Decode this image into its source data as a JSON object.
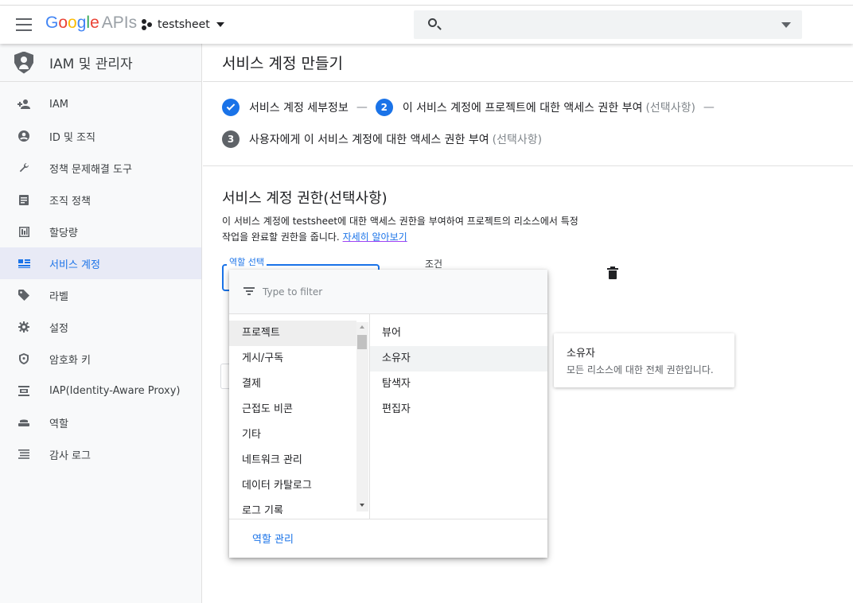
{
  "header": {
    "logo_google": "Google",
    "logo_apis": "APIs",
    "project_name": "testsheet"
  },
  "sidebar": {
    "title": "IAM 및 관리자",
    "items": [
      {
        "label": "IAM",
        "icon": "person-add-icon"
      },
      {
        "label": "ID 및 조직",
        "icon": "account-circle-icon"
      },
      {
        "label": "정책 문제해결 도구",
        "icon": "wrench-icon"
      },
      {
        "label": "조직 정책",
        "icon": "document-icon"
      },
      {
        "label": "할당량",
        "icon": "quota-icon"
      },
      {
        "label": "서비스 계정",
        "icon": "service-account-icon",
        "active": true
      },
      {
        "label": "라벨",
        "icon": "tag-icon"
      },
      {
        "label": "설정",
        "icon": "gear-icon"
      },
      {
        "label": "암호화 키",
        "icon": "shield-key-icon"
      },
      {
        "label": "IAP(Identity-Aware Proxy)",
        "icon": "iap-icon"
      },
      {
        "label": "역할",
        "icon": "role-icon"
      },
      {
        "label": "감사 로그",
        "icon": "list-icon"
      }
    ]
  },
  "main": {
    "page_title": "서비스 계정 만들기",
    "steps": {
      "step1_label": "서비스 계정 세부정보",
      "step2_number": "2",
      "step2_label": "이 서비스 계정에 프로젝트에 대한 액세스 권한 부여",
      "step2_optional": "(선택사항)",
      "step3_number": "3",
      "step3_label": "사용자에게 이 서비스 계정에 대한 액세스 권한 부여",
      "step3_optional": "(선택사항)",
      "separator": "—"
    },
    "section_title": "서비스 계정 권한(선택사항)",
    "description_line1": "이 서비스 계정에 testsheet에 대한 액세스 권한을 부여하여 프로젝트의 리소스에서 특정",
    "description_line2": "작업을 완료할 권한을 줍니다.",
    "learn_more": "자세히 알아보기",
    "role_select_label": "역할 선택",
    "condition_label": "조건"
  },
  "dropdown": {
    "filter_placeholder": "Type to filter",
    "categories": [
      "프로젝트",
      "게시/구독",
      "결제",
      "근접도 비콘",
      "기타",
      "네트워크 관리",
      "데이터 카탈로그",
      "로그 기록"
    ],
    "selected_category": "프로젝트",
    "roles": [
      "뷰어",
      "소유자",
      "탐색자",
      "편집자"
    ],
    "hovered_role": "소유자",
    "manage_roles": "역할 관리"
  },
  "tooltip": {
    "title": "소유자",
    "description": "모든 리소스에 대한 전체 권한입니다."
  },
  "colors": {
    "accent": "#1a73e8",
    "sidebar_active_bg": "#e8eaf6"
  }
}
